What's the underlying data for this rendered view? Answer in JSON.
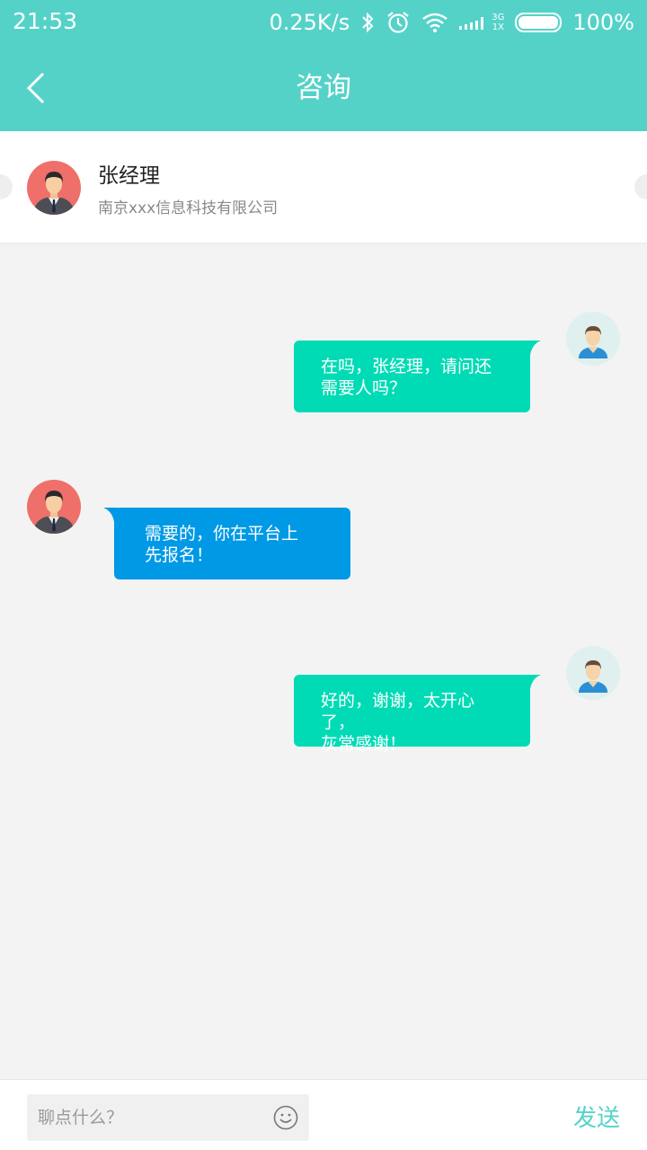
{
  "status_bar": {
    "time": "21:53",
    "net_speed": "0.25K/s",
    "network_type_top": "3G",
    "network_type_bottom": "1X",
    "battery": "100%"
  },
  "header": {
    "title": "咨询"
  },
  "contact": {
    "name": "张经理",
    "company": "南京xxx信息科技有限公司"
  },
  "messages": [
    {
      "side": "right",
      "line1": "在吗，张经理，请问还",
      "line2": "需要人吗？"
    },
    {
      "side": "left",
      "line1": "需要的，你在平台上",
      "line2": "先报名！"
    },
    {
      "side": "right",
      "line1": "好的，谢谢，太开心了，",
      "line2": "灰常感谢！"
    }
  ],
  "footer": {
    "input_placeholder": "聊点什么？",
    "send_label": "发送"
  },
  "colors": {
    "primary": "#55d2c8",
    "bubble_right": "#00dbb6",
    "bubble_left": "#0099e6",
    "background": "#f3f3f3"
  }
}
